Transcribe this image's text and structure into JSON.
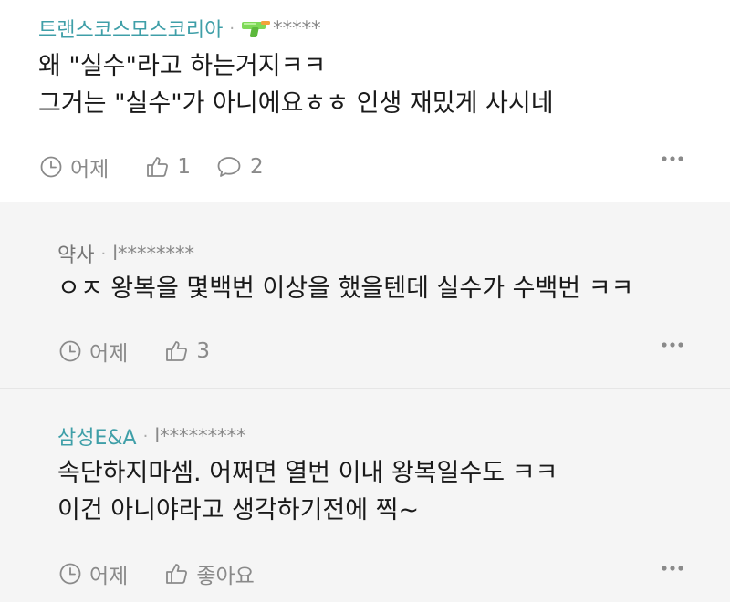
{
  "comments": [
    {
      "author": "트랜스코스모스코리아",
      "author_id": "*****",
      "lines": [
        "왜 \"실수\"라고 하는거지ㅋㅋ",
        "그거는 \"실수\"가 아니에요ㅎㅎ 인생 재밌게 사시네"
      ],
      "time": "어제",
      "likes": "1",
      "replies": "2"
    },
    {
      "author": "약사",
      "author_id": "l********",
      "lines": [
        "ㅇㅈ 왕복을 몇백번 이상을 했을텐데 실수가 수백번 ㅋㅋ"
      ],
      "time": "어제",
      "likes": "3"
    },
    {
      "author": "삼성E&A",
      "author_id": "l*********",
      "lines": [
        "속단하지마셈. 어쩌면 열번 이내 왕복일수도 ㅋㅋ",
        "이건 아니야라고 생각하기전에 찍~"
      ],
      "time": "어제",
      "likes": "좋아요"
    }
  ],
  "colors": {
    "author_accent": "#3f9fa8",
    "reply_bg": "#f5f5f5",
    "meta_gray": "#8a8a8a"
  },
  "icons": [
    "water-gun-emoji",
    "clock-icon",
    "thumbs-up-icon",
    "speech-bubble-icon",
    "more-dots-icon"
  ]
}
